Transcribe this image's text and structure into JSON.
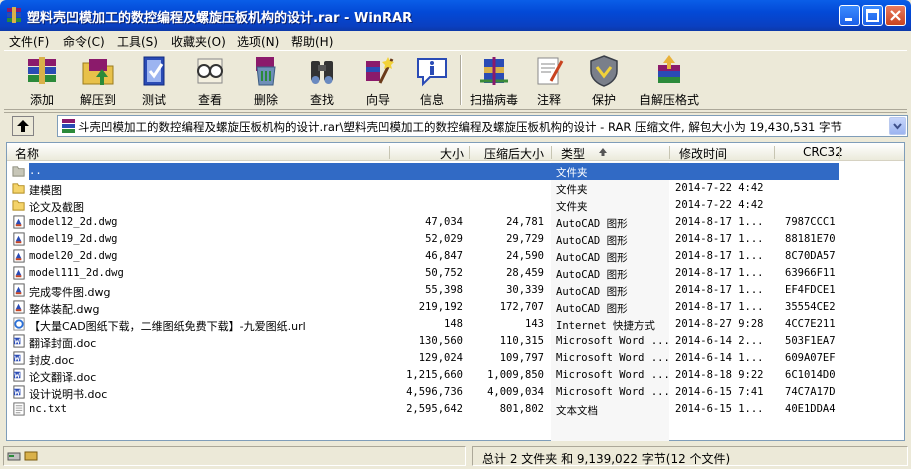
{
  "window": {
    "title": "塑料壳凹模加工的数控编程及螺旋压板机构的设计.rar - WinRAR"
  },
  "menu": [
    "文件(F)",
    "命令(C)",
    "工具(S)",
    "收藏夹(O)",
    "选项(N)",
    "帮助(H)"
  ],
  "toolbar": [
    {
      "label": "添加",
      "icon": "add-books-icon"
    },
    {
      "label": "解压到",
      "icon": "extract-folder-icon"
    },
    {
      "label": "测试",
      "icon": "test-book-icon"
    },
    {
      "label": "查看",
      "icon": "view-glasses-icon"
    },
    {
      "label": "删除",
      "icon": "delete-recycle-icon"
    },
    {
      "label": "查找",
      "icon": "find-binoculars-icon"
    },
    {
      "label": "向导",
      "icon": "wizard-icon"
    },
    {
      "label": "信息",
      "icon": "info-icon"
    },
    {
      "label": "扫描病毒",
      "icon": "virus-scan-icon"
    },
    {
      "label": "注释",
      "icon": "comment-icon"
    },
    {
      "label": "保护",
      "icon": "protect-shield-icon"
    },
    {
      "label": "自解压格式",
      "icon": "sfx-icon"
    }
  ],
  "address": {
    "path": "斗壳凹模加工的数控编程及螺旋压板机构的设计.rar\\塑料壳凹模加工的数控编程及螺旋压板机构的设计 - RAR 压缩文件, 解包大小为 19,430,531 字节"
  },
  "columns": {
    "name": "名称",
    "size": "大小",
    "packed": "压缩后大小",
    "type": "类型",
    "modified": "修改时间",
    "crc": "CRC32"
  },
  "files": [
    {
      "name": "..",
      "size": "",
      "packed": "",
      "type": "文件夹",
      "modified": "",
      "crc": "",
      "icon": "parent-folder-icon",
      "selected": true
    },
    {
      "name": "建模图",
      "size": "",
      "packed": "",
      "type": "文件夹",
      "modified": "2014-7-22 4:42",
      "crc": "",
      "icon": "folder-icon"
    },
    {
      "name": "论文及截图",
      "size": "",
      "packed": "",
      "type": "文件夹",
      "modified": "2014-7-22 4:42",
      "crc": "",
      "icon": "folder-icon"
    },
    {
      "name": "model12_2d.dwg",
      "size": "47,034",
      "packed": "24,781",
      "type": "AutoCAD 图形",
      "modified": "2014-8-17 1...",
      "crc": "7987CCC1",
      "icon": "dwg-file-icon"
    },
    {
      "name": "model19_2d.dwg",
      "size": "52,029",
      "packed": "29,729",
      "type": "AutoCAD 图形",
      "modified": "2014-8-17 1...",
      "crc": "88181E70",
      "icon": "dwg-file-icon"
    },
    {
      "name": "model20_2d.dwg",
      "size": "46,847",
      "packed": "24,590",
      "type": "AutoCAD 图形",
      "modified": "2014-8-17 1...",
      "crc": "8C70DA57",
      "icon": "dwg-file-icon"
    },
    {
      "name": "model111_2d.dwg",
      "size": "50,752",
      "packed": "28,459",
      "type": "AutoCAD 图形",
      "modified": "2014-8-17 1...",
      "crc": "63966F11",
      "icon": "dwg-file-icon"
    },
    {
      "name": "完成零件图.dwg",
      "size": "55,398",
      "packed": "30,339",
      "type": "AutoCAD 图形",
      "modified": "2014-8-17 1...",
      "crc": "EF4FDCE1",
      "icon": "dwg-file-icon"
    },
    {
      "name": "整体装配.dwg",
      "size": "219,192",
      "packed": "172,707",
      "type": "AutoCAD 图形",
      "modified": "2014-8-17 1...",
      "crc": "35554CE2",
      "icon": "dwg-file-icon"
    },
    {
      "name": "【大量CAD图纸下载，二维图纸免费下载】-九爱图纸.url",
      "size": "148",
      "packed": "143",
      "type": "Internet 快捷方式",
      "modified": "2014-8-27 9:28",
      "crc": "4CC7E211",
      "icon": "internet-shortcut-icon"
    },
    {
      "name": "翻译封面.doc",
      "size": "130,560",
      "packed": "110,315",
      "type": "Microsoft Word ...",
      "modified": "2014-6-14 2...",
      "crc": "503F1EA7",
      "icon": "word-doc-icon"
    },
    {
      "name": "封皮.doc",
      "size": "129,024",
      "packed": "109,797",
      "type": "Microsoft Word ...",
      "modified": "2014-6-14 1...",
      "crc": "609A07EF",
      "icon": "word-doc-icon"
    },
    {
      "name": "论文翻译.doc",
      "size": "1,215,660",
      "packed": "1,009,850",
      "type": "Microsoft Word ...",
      "modified": "2014-8-18 9:22",
      "crc": "6C1014D0",
      "icon": "word-doc-icon"
    },
    {
      "name": "设计说明书.doc",
      "size": "4,596,736",
      "packed": "4,009,034",
      "type": "Microsoft Word ...",
      "modified": "2014-6-15 7:41",
      "crc": "74C7A17D",
      "icon": "word-doc-icon"
    },
    {
      "name": "nc.txt",
      "size": "2,595,642",
      "packed": "801,802",
      "type": "文本文档",
      "modified": "2014-6-15 1...",
      "crc": "40E1DDA4",
      "icon": "text-file-icon"
    }
  ],
  "status": {
    "text": "总计 2 文件夹 和 9,139,022 字节(12 个文件)"
  }
}
